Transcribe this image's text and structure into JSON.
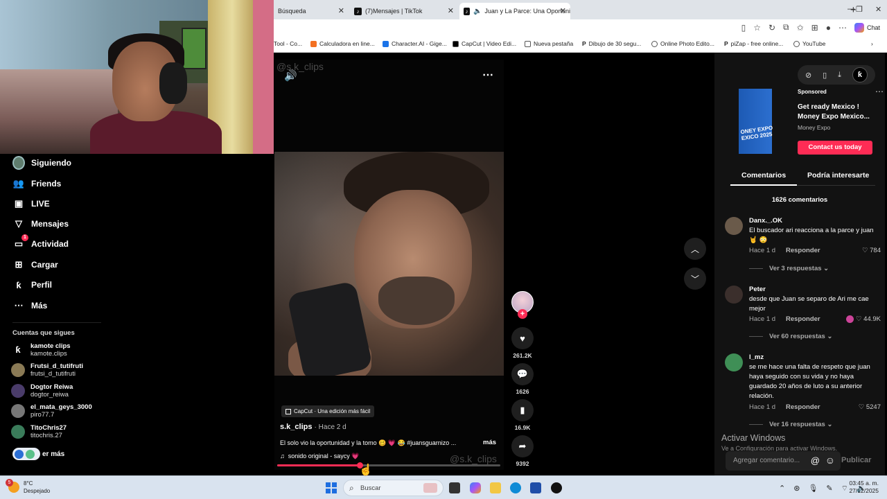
{
  "tabs": [
    {
      "label": "Búsqueda"
    },
    {
      "label": "(7)Mensajes | TikTok"
    },
    {
      "label": "Juan y La Parce: Una Oportuni"
    }
  ],
  "bookmarks": [
    {
      "label": "Tool - Co..."
    },
    {
      "label": "Calculadora en line..."
    },
    {
      "label": "Character.AI - Gige..."
    },
    {
      "label": "CapCut | Video Edi..."
    },
    {
      "label": "Nueva pestaña"
    },
    {
      "label": "Dibujo de 30 segu..."
    },
    {
      "label": "Online Photo Edito..."
    },
    {
      "label": "piZap - free online..."
    },
    {
      "label": "YouTube"
    }
  ],
  "browser": {
    "chat_label": "Chat"
  },
  "nav": {
    "items": [
      {
        "label": "Siguiendo"
      },
      {
        "label": "Friends"
      },
      {
        "label": "LIVE"
      },
      {
        "label": "Mensajes"
      },
      {
        "label": "Actividad",
        "badge": "1"
      },
      {
        "label": "Cargar"
      },
      {
        "label": "Perfil"
      },
      {
        "label": "Más"
      }
    ],
    "following_header": "Cuentas que sigues",
    "following": [
      {
        "name": "kamote clips",
        "user": "kamote.clips"
      },
      {
        "name": "Frutsi_d_tutifruti",
        "user": "frutsi_d_tutifruti"
      },
      {
        "name": "Dogtor Reiwa",
        "user": "dogtor_reiwa"
      },
      {
        "name": "el_mata_geys_3000",
        "user": "piro77.7"
      },
      {
        "name": "TitoChris27",
        "user": "titochris.27"
      }
    ],
    "ver_mas": "er más"
  },
  "video": {
    "watermark": "@s.k_clips",
    "capcut": "CapCut · Una edición más fácil",
    "author": "s.k_clips",
    "time": "· Hace 2 d",
    "caption": "El solo vio la oportunidad y la tomo 🥴 💗 😂 #juansguarnizo ...",
    "caption_more": "más",
    "music": "sonido original - saycy 💗",
    "progress": 0.37,
    "likes": "261.2K",
    "comments": "1626",
    "saves": "16.9K",
    "shares": "9392"
  },
  "ad": {
    "sponsored": "Sponsored",
    "title": "Get ready Mexico ! Money Expo Mexico...",
    "brand": "Money Expo",
    "cta": "Contact us today",
    "image_text": "ONEY EXPO\nEXICO 2025"
  },
  "right": {
    "tab_comments": "Comentarios",
    "tab_interest": "Podría interesarte",
    "comment_count": "1626 comentarios",
    "comments": [
      {
        "user": "Danx._.OK",
        "text": "El buscador ari reacciona a la parce y juan 🤘 😳",
        "time": "Hace 1 d",
        "reply": "Responder",
        "likes": "784",
        "replies": "Ver 3 respuestas"
      },
      {
        "user": "Peter",
        "text": "desde que Juan se separo de Ari me cae mejor",
        "time": "Hace 1 d",
        "reply": "Responder",
        "likes": "44.9K",
        "replies": "Ver 60 respuestas"
      },
      {
        "user": "l_mz",
        "text": "se me hace una falta de respeto que juan haya seguido con su vida y no haya guardado 20 años de luto a su anterior relación.",
        "time": "Hace 1 d",
        "reply": "Responder",
        "likes": "5247",
        "replies": "Ver 16 respuestas"
      }
    ],
    "placeholder": "Agregar comentario...",
    "publish": "Publicar",
    "activate_title": "Activar Windows",
    "activate_sub": "Ve a Configuración para activar Windows."
  },
  "taskbar": {
    "temp": "8°C",
    "weather": "Despejado",
    "weather_badge": "5",
    "search": "Buscar",
    "time": "03:45 a. m.",
    "date": "27/12/2025"
  },
  "colors": {
    "accent": "#fe2c55",
    "panel": "#121212"
  }
}
